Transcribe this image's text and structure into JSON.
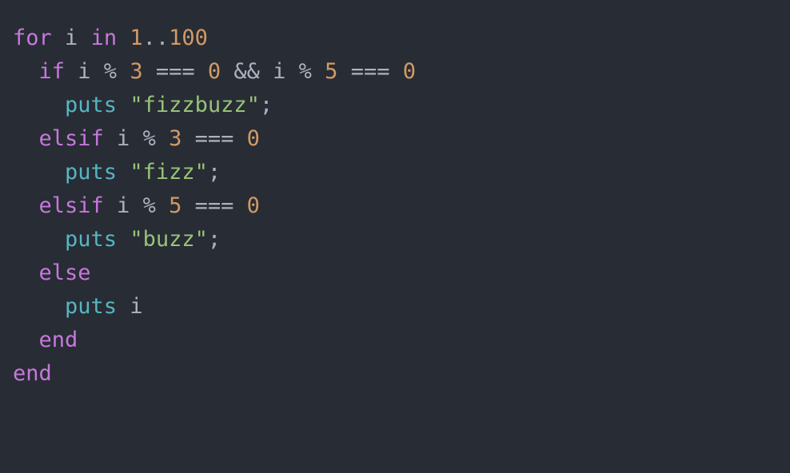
{
  "editor": {
    "colors": {
      "background": "#282c34",
      "keyword": "#c678dd",
      "number": "#d19a66",
      "function": "#56b6c2",
      "string": "#98c379",
      "text": "#abb2bf"
    },
    "lines": [
      {
        "tokens": [
          {
            "text": "for",
            "type": "kw"
          },
          {
            "text": " i ",
            "type": "txt"
          },
          {
            "text": "in",
            "type": "kw"
          },
          {
            "text": " ",
            "type": "txt"
          },
          {
            "text": "1",
            "type": "num"
          },
          {
            "text": "..",
            "type": "txt"
          },
          {
            "text": "100",
            "type": "num"
          }
        ]
      },
      {
        "tokens": [
          {
            "text": "  ",
            "type": "txt"
          },
          {
            "text": "if",
            "type": "kw"
          },
          {
            "text": " i % ",
            "type": "txt"
          },
          {
            "text": "3",
            "type": "num"
          },
          {
            "text": " === ",
            "type": "txt"
          },
          {
            "text": "0",
            "type": "num"
          },
          {
            "text": " && i % ",
            "type": "txt"
          },
          {
            "text": "5",
            "type": "num"
          },
          {
            "text": " === ",
            "type": "txt"
          },
          {
            "text": "0",
            "type": "num"
          }
        ]
      },
      {
        "tokens": [
          {
            "text": "    ",
            "type": "txt"
          },
          {
            "text": "puts",
            "type": "fn"
          },
          {
            "text": " ",
            "type": "txt"
          },
          {
            "text": "\"fizzbuzz\"",
            "type": "str"
          },
          {
            "text": ";",
            "type": "txt"
          }
        ]
      },
      {
        "tokens": [
          {
            "text": "  ",
            "type": "txt"
          },
          {
            "text": "elsif",
            "type": "kw"
          },
          {
            "text": " i % ",
            "type": "txt"
          },
          {
            "text": "3",
            "type": "num"
          },
          {
            "text": " === ",
            "type": "txt"
          },
          {
            "text": "0",
            "type": "num"
          }
        ]
      },
      {
        "tokens": [
          {
            "text": "    ",
            "type": "txt"
          },
          {
            "text": "puts",
            "type": "fn"
          },
          {
            "text": " ",
            "type": "txt"
          },
          {
            "text": "\"fizz\"",
            "type": "str"
          },
          {
            "text": ";",
            "type": "txt"
          }
        ]
      },
      {
        "tokens": [
          {
            "text": "  ",
            "type": "txt"
          },
          {
            "text": "elsif",
            "type": "kw"
          },
          {
            "text": " i % ",
            "type": "txt"
          },
          {
            "text": "5",
            "type": "num"
          },
          {
            "text": " === ",
            "type": "txt"
          },
          {
            "text": "0",
            "type": "num"
          }
        ]
      },
      {
        "tokens": [
          {
            "text": "    ",
            "type": "txt"
          },
          {
            "text": "puts",
            "type": "fn"
          },
          {
            "text": " ",
            "type": "txt"
          },
          {
            "text": "\"buzz\"",
            "type": "str"
          },
          {
            "text": ";",
            "type": "txt"
          }
        ]
      },
      {
        "tokens": [
          {
            "text": "  ",
            "type": "txt"
          },
          {
            "text": "else",
            "type": "kw"
          }
        ]
      },
      {
        "tokens": [
          {
            "text": "    ",
            "type": "txt"
          },
          {
            "text": "puts",
            "type": "fn"
          },
          {
            "text": " i",
            "type": "txt"
          }
        ]
      },
      {
        "tokens": [
          {
            "text": "  ",
            "type": "txt"
          },
          {
            "text": "end",
            "type": "kw"
          }
        ]
      },
      {
        "tokens": [
          {
            "text": "end",
            "type": "kw"
          }
        ]
      }
    ]
  }
}
